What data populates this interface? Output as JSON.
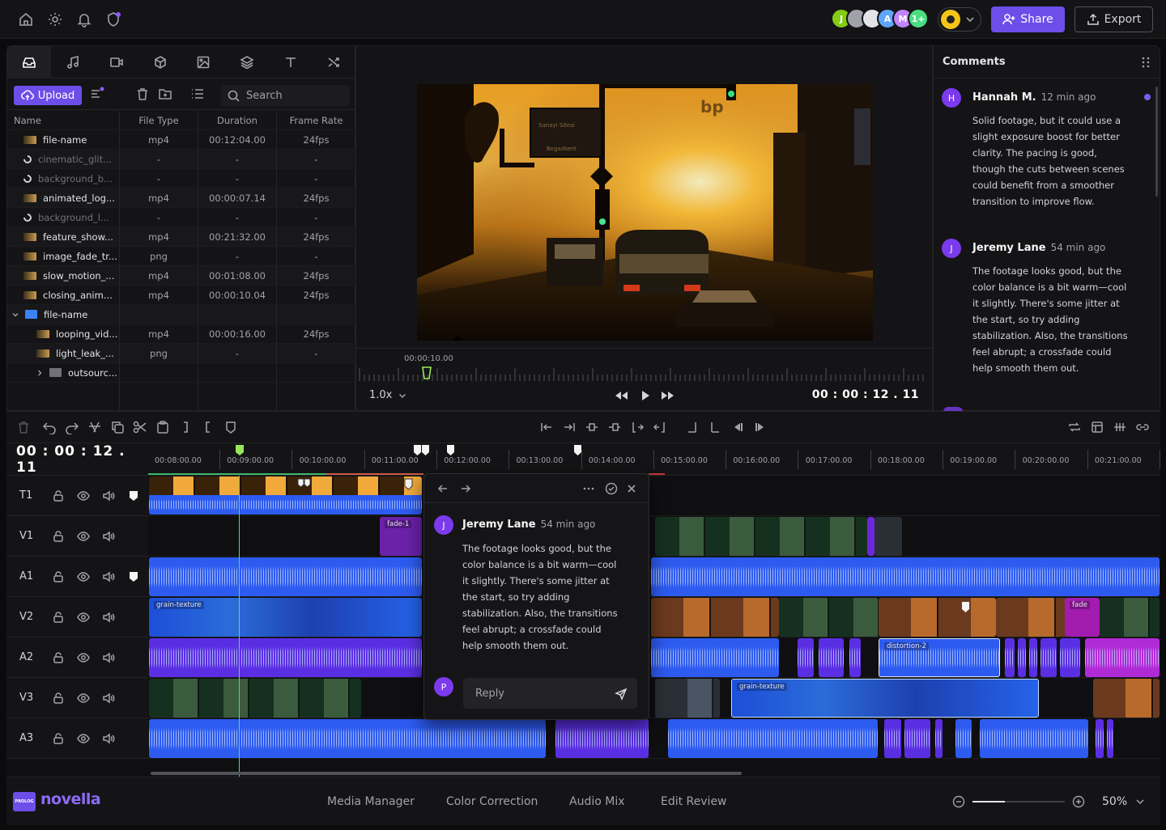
{
  "topbar": {
    "avatars": [
      {
        "initial": "J",
        "color": "#84cc16"
      },
      {
        "initial": "",
        "color": "#a1a1aa"
      },
      {
        "initial": "",
        "color": "#e4e4e7"
      },
      {
        "initial": "A",
        "color": "#60a5fa"
      },
      {
        "initial": "M",
        "color": "#c084fc"
      },
      {
        "initial": "1+",
        "color": "#4ade80"
      }
    ],
    "share_label": "Share",
    "export_label": "Export",
    "accent": "#6d4ee8"
  },
  "media": {
    "upload_label": "Upload",
    "search_placeholder": "Search",
    "columns": [
      "Name",
      "File Type",
      "Duration",
      "Frame Rate"
    ],
    "rows": [
      {
        "name": "file-name",
        "type": "mp4",
        "duration": "00:12:04.00",
        "fps": "24fps",
        "kind": "thumb",
        "indent": 0,
        "dim": false
      },
      {
        "name": "cinematic_glit...",
        "type": "-",
        "duration": "-",
        "fps": "-",
        "kind": "circle",
        "indent": 0,
        "dim": true
      },
      {
        "name": "background_b...",
        "type": "-",
        "duration": "-",
        "fps": "-",
        "kind": "circle",
        "indent": 0,
        "dim": true
      },
      {
        "name": "animated_log...",
        "type": "mp4",
        "duration": "00:00:07.14",
        "fps": "24fps",
        "kind": "thumb",
        "indent": 0,
        "dim": false
      },
      {
        "name": "background_l...",
        "type": "-",
        "duration": "-",
        "fps": "-",
        "kind": "circle",
        "indent": 0,
        "dim": true
      },
      {
        "name": "feature_show...",
        "type": "mp4",
        "duration": "00:21:32.00",
        "fps": "24fps",
        "kind": "thumb",
        "indent": 0,
        "dim": false
      },
      {
        "name": "image_fade_tr...",
        "type": "png",
        "duration": "-",
        "fps": "-",
        "kind": "thumb",
        "indent": 0,
        "dim": false
      },
      {
        "name": "slow_motion_...",
        "type": "mp4",
        "duration": "00:01:08.00",
        "fps": "24fps",
        "kind": "thumb",
        "indent": 0,
        "dim": false
      },
      {
        "name": "closing_anim...",
        "type": "mp4",
        "duration": "00:00:10.04",
        "fps": "24fps",
        "kind": "thumb",
        "indent": 0,
        "dim": false
      },
      {
        "name": "file-name",
        "type": "",
        "duration": "",
        "fps": "",
        "kind": "folder",
        "indent": 0,
        "dim": false
      },
      {
        "name": "looping_vid...",
        "type": "mp4",
        "duration": "00:00:16.00",
        "fps": "24fps",
        "kind": "thumb",
        "indent": 1,
        "dim": false
      },
      {
        "name": "light_leak_...",
        "type": "png",
        "duration": "-",
        "fps": "-",
        "kind": "thumb",
        "indent": 1,
        "dim": false
      },
      {
        "name": "outsourc...",
        "type": "",
        "duration": "",
        "fps": "",
        "kind": "folder-grey",
        "indent": 1,
        "dim": false
      }
    ]
  },
  "viewer": {
    "ruler_time": "00:00:10.00",
    "zoom": "1.0x",
    "timecode": "00 : 00 : 12 . 11",
    "sign_text_1": "Sanayi Sitesi",
    "sign_text_2": "Bogazkent"
  },
  "comments": {
    "title": "Comments",
    "items": [
      {
        "initial": "H",
        "name": "Hannah M.",
        "time": "12 min ago",
        "text": "Solid footage, but it could use a slight exposure boost for better clarity. The pacing is good, though the cuts between scenes could benefit from a smoother transition to improve flow."
      },
      {
        "initial": "J",
        "name": "Jeremy Lane",
        "time": "54 min ago",
        "text": "The footage looks good, but the color balance is a bit warm—cool it slightly. There's some jitter at the start, so try adding stabilization. Also, the transitions feel abrupt; a crossfade could help smooth them out."
      }
    ]
  },
  "timeline": {
    "timecode": "00 : 00 : 12 . 11",
    "ruler_labels": [
      "00:08:00.00",
      "00:09:00.00",
      "00:10:00.00",
      "00:11:00.00",
      "00:12:00.00",
      "00:13:00.00",
      "00:14:00.00",
      "00:15:00.00",
      "00:16:00.00",
      "00:17:00.00",
      "00:18:00.00",
      "00:19:00.00",
      "00:20:00.00",
      "00:21:00.00"
    ],
    "tracks": [
      "T1",
      "V1",
      "A1",
      "V2",
      "A2",
      "V3",
      "A3"
    ],
    "clip_labels": {
      "fade1": "fade-1",
      "grain1": "grain-texture",
      "fade2": "fade",
      "distortion": "distortion-2",
      "grain2": "grain-texture"
    }
  },
  "popup": {
    "initial": "J",
    "name": "Jeremy Lane",
    "time": "54 min ago",
    "text": "The footage looks good, but the color balance is a bit warm—cool it slightly. There's some jitter at the start, so try adding stabilization. Also, the transitions feel abrupt; a crossfade could help smooth them out.",
    "reply_initial": "P",
    "reply_placeholder": "Reply"
  },
  "bottombar": {
    "brand": "novella",
    "logo_text": "PROLOG",
    "nav": [
      "Media Manager",
      "Color Correction",
      "Audio Mix",
      "Edit Review"
    ],
    "zoom": "50%"
  }
}
